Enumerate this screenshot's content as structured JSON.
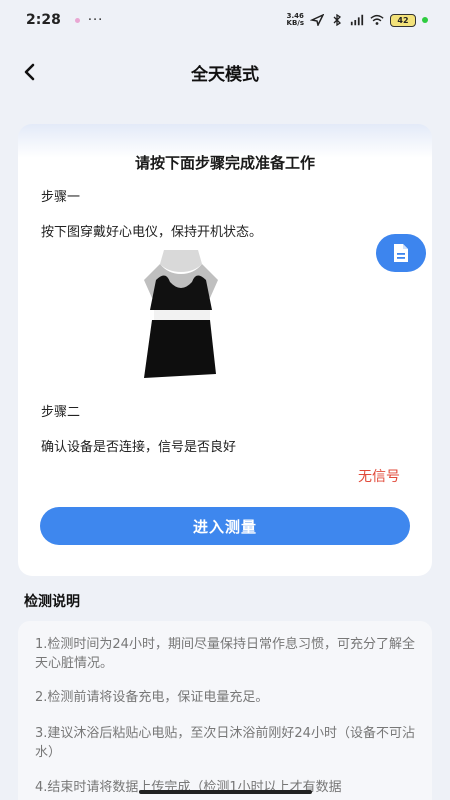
{
  "status_bar": {
    "time": "2:28",
    "more": "···",
    "net_speed_value": "3.46",
    "net_speed_unit": "KB/s",
    "battery": "42"
  },
  "header": {
    "title": "全天模式"
  },
  "prep_card": {
    "title": "请按下面步骤完成准备工作",
    "step1_label": "步骤一",
    "step1_text": "按下图穿戴好心电仪，保持开机状态。",
    "step2_label": "步骤二",
    "step2_text": "确认设备是否连接，信号是否良好",
    "signal_status": "无信号",
    "enter_button_label": "进入测量"
  },
  "instructions": {
    "title": "检测说明",
    "notes": [
      "1.检测时间为24小时，期间尽量保持日常作息习惯，可充分了解全天心脏情况。",
      "2.检测前请将设备充电，保证电量充足。",
      "3.建议沐浴后粘贴心电贴，至次日沐浴前刚好24小时（设备不可沾水）",
      "4.结束时请将数据上传完成（检测1小时以上才有数据"
    ]
  },
  "colors": {
    "accent": "#3e87ee",
    "warning": "#e14b3b",
    "background": "#eef1f7"
  },
  "icons": {
    "back": "chevron-left-icon",
    "fab": "document-icon"
  }
}
